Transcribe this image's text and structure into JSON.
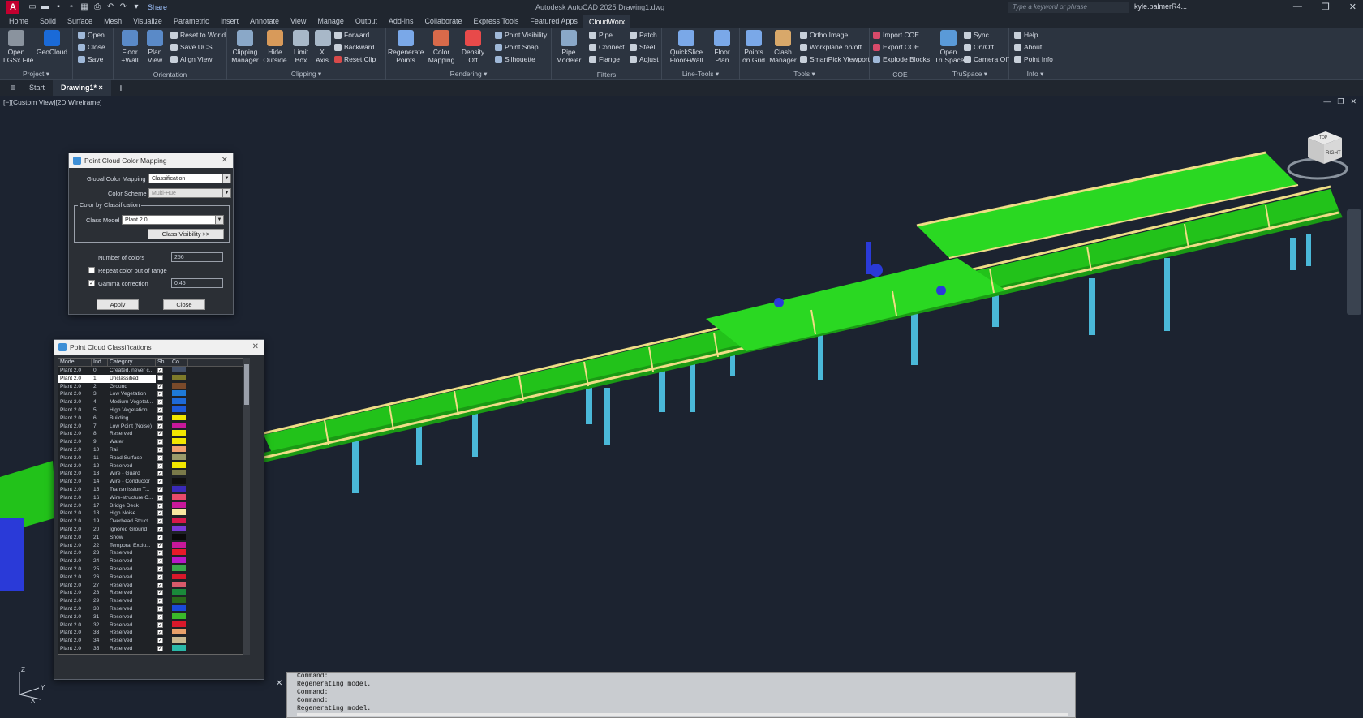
{
  "app": {
    "title": "Autodesk AutoCAD 2025 Drawing1.dwg",
    "share": "Share",
    "search_placeholder": "Type a keyword or phrase",
    "user": "kyle.palmerR4..."
  },
  "menu_tabs": [
    "Home",
    "Solid",
    "Surface",
    "Mesh",
    "Visualize",
    "Parametric",
    "Insert",
    "Annotate",
    "View",
    "Manage",
    "Output",
    "Add-ins",
    "Collaborate",
    "Express Tools",
    "Featured Apps",
    "CloudWorx"
  ],
  "active_menu_tab": "CloudWorx",
  "ribbon": {
    "project": {
      "title": "Project ▾",
      "open_lgsx": "Open\nLGSx File",
      "geocloud": "GeoCloud",
      "open": "Open",
      "close": "Close",
      "save": "Save"
    },
    "orientation": {
      "title": "Orientation",
      "floor_wall": "Floor\n+Wall",
      "plan_view": "Plan\nView",
      "reset_world": "Reset to World",
      "save_ucs": "Save UCS",
      "align_view": "Align View"
    },
    "clipping": {
      "title": "Clipping ▾",
      "clipping_manager": "Clipping\nManager",
      "hide_outside": "Hide\nOutside",
      "limit_box": "Limit\nBox",
      "x_axis": "X\nAxis",
      "forward": "Forward",
      "backward": "Backward",
      "reset_clip": "Reset Clip"
    },
    "rendering": {
      "title": "Rendering ▾",
      "regenerate": "Regenerate\nPoints",
      "color_mapping": "Color\nMapping",
      "density_off": "Density\nOff",
      "point_visibility": "Point Visibility",
      "point_snap": "Point Snap",
      "silhouette": "Silhouette"
    },
    "fitters": {
      "title": "Fitters",
      "pipe_modeler": "Pipe\nModeler",
      "pipe": "Pipe",
      "connect": "Connect",
      "flange": "Flange",
      "patch": "Patch",
      "steel": "Steel",
      "adjust": "Adjust"
    },
    "line_tools": {
      "title": "Line-Tools ▾",
      "quickslice": "QuickSlice\nFloor+Wall",
      "floor_plan": "Floor\nPlan"
    },
    "tools": {
      "title": "Tools ▾",
      "points_on_grid": "Points\non Grid",
      "clash_manager": "Clash\nManager",
      "ortho_image": "Ortho Image...",
      "workplane": "Workplane on/off",
      "smartpick": "SmartPick Viewport"
    },
    "coe": {
      "title": "COE",
      "import_coe": "Import COE",
      "export_coe": "Export COE",
      "explode_blocks": "Explode Blocks"
    },
    "truspace": {
      "title": "TruSpace ▾",
      "open_truspace": "Open\nTruSpace",
      "sync": "Sync...",
      "on_off": "On/Off",
      "camera_off": "Camera Off"
    },
    "info": {
      "title": "Info ▾",
      "help": "Help",
      "about": "About",
      "point_info": "Point Info"
    }
  },
  "doc_tabs": {
    "start": "Start",
    "drawing": "Drawing1*",
    "drawing_close": "×"
  },
  "viewport": {
    "label": "[−][Custom View][2D Wireframe]",
    "viewcube_face": "RIGHT",
    "viewcube_top": "TOP"
  },
  "color_mapping_dialog": {
    "title": "Point Cloud Color Mapping",
    "global_color_mapping_label": "Global Color Mapping",
    "global_color_mapping_value": "Classification",
    "color_scheme_label": "Color Scheme",
    "color_scheme_value": "Multi-Hue",
    "group_title": "Color by Classification",
    "class_model_label": "Class Model",
    "class_model_value": "Plant 2.0",
    "class_visibility": "Class Visibility >>",
    "number_of_colors_label": "Number of colors",
    "number_of_colors_value": "256",
    "repeat_label": "Repeat color out of range",
    "repeat_checked": false,
    "gamma_label": "Gamma correction",
    "gamma_checked": true,
    "gamma_value": "0.45",
    "apply": "Apply",
    "close": "Close"
  },
  "classification_dialog": {
    "title": "Point Cloud Classifications",
    "columns": [
      "Model",
      "Ind...",
      "Category",
      "Sh...",
      "Co..."
    ],
    "selected_index": 1,
    "rows": [
      {
        "model": "Plant 2.0",
        "idx": "0",
        "cat": "Created, never c...",
        "shown": true,
        "color": "#44526a"
      },
      {
        "model": "Plant 2.0",
        "idx": "1",
        "cat": "Unclassified",
        "shown": false,
        "color": "#7d7a2a"
      },
      {
        "model": "Plant 2.0",
        "idx": "2",
        "cat": "Ground",
        "shown": true,
        "color": "#7a4a2a"
      },
      {
        "model": "Plant 2.0",
        "idx": "3",
        "cat": "Low Vegetation",
        "shown": true,
        "color": "#1e7ad8"
      },
      {
        "model": "Plant 2.0",
        "idx": "4",
        "cat": "Medium Vegetat...",
        "shown": true,
        "color": "#1e6ad8"
      },
      {
        "model": "Plant 2.0",
        "idx": "5",
        "cat": "High Vegetation",
        "shown": true,
        "color": "#1e5ad8"
      },
      {
        "model": "Plant 2.0",
        "idx": "6",
        "cat": "Building",
        "shown": true,
        "color": "#f2e600"
      },
      {
        "model": "Plant 2.0",
        "idx": "7",
        "cat": "Low Point (Noise)",
        "shown": true,
        "color": "#c8189a"
      },
      {
        "model": "Plant 2.0",
        "idx": "8",
        "cat": "Reserved",
        "shown": true,
        "color": "#f2e600"
      },
      {
        "model": "Plant 2.0",
        "idx": "9",
        "cat": "Water",
        "shown": true,
        "color": "#f2e600"
      },
      {
        "model": "Plant 2.0",
        "idx": "10",
        "cat": "Rail",
        "shown": true,
        "color": "#f0a070"
      },
      {
        "model": "Plant 2.0",
        "idx": "11",
        "cat": "Road Surface",
        "shown": true,
        "color": "#9a9a6a"
      },
      {
        "model": "Plant 2.0",
        "idx": "12",
        "cat": "Reserved",
        "shown": true,
        "color": "#f2e600"
      },
      {
        "model": "Plant 2.0",
        "idx": "13",
        "cat": "Wire - Guard",
        "shown": true,
        "color": "#7a7a4a"
      },
      {
        "model": "Plant 2.0",
        "idx": "14",
        "cat": "Wire - Conductor",
        "shown": true,
        "color": "#111111"
      },
      {
        "model": "Plant 2.0",
        "idx": "15",
        "cat": "Transmission T...",
        "shown": true,
        "color": "#3a2ab8"
      },
      {
        "model": "Plant 2.0",
        "idx": "16",
        "cat": "Wire-structure C...",
        "shown": true,
        "color": "#e84a6a"
      },
      {
        "model": "Plant 2.0",
        "idx": "17",
        "cat": "Bridge Deck",
        "shown": true,
        "color": "#c8189a"
      },
      {
        "model": "Plant 2.0",
        "idx": "18",
        "cat": "High Noise",
        "shown": true,
        "color": "#f8e8a0"
      },
      {
        "model": "Plant 2.0",
        "idx": "19",
        "cat": "Overhead Struct...",
        "shown": true,
        "color": "#d8184a"
      },
      {
        "model": "Plant 2.0",
        "idx": "20",
        "cat": "Ignored Ground",
        "shown": true,
        "color": "#7a3ad8"
      },
      {
        "model": "Plant 2.0",
        "idx": "21",
        "cat": "Snow",
        "shown": true,
        "color": "#0a0a0a"
      },
      {
        "model": "Plant 2.0",
        "idx": "22",
        "cat": "Temporal Exclu...",
        "shown": true,
        "color": "#c8189a"
      },
      {
        "model": "Plant 2.0",
        "idx": "23",
        "cat": "Reserved",
        "shown": true,
        "color": "#e81a2a"
      },
      {
        "model": "Plant 2.0",
        "idx": "24",
        "cat": "Reserved",
        "shown": true,
        "color": "#b818c8"
      },
      {
        "model": "Plant 2.0",
        "idx": "25",
        "cat": "Reserved",
        "shown": true,
        "color": "#3aa84a"
      },
      {
        "model": "Plant 2.0",
        "idx": "26",
        "cat": "Reserved",
        "shown": true,
        "color": "#d8182a"
      },
      {
        "model": "Plant 2.0",
        "idx": "27",
        "cat": "Reserved",
        "shown": true,
        "color": "#d85a6a"
      },
      {
        "model": "Plant 2.0",
        "idx": "28",
        "cat": "Reserved",
        "shown": true,
        "color": "#1a8a3a"
      },
      {
        "model": "Plant 2.0",
        "idx": "29",
        "cat": "Reserved",
        "shown": true,
        "color": "#2a6a1a"
      },
      {
        "model": "Plant 2.0",
        "idx": "30",
        "cat": "Reserved",
        "shown": true,
        "color": "#1a4ad8"
      },
      {
        "model": "Plant 2.0",
        "idx": "31",
        "cat": "Reserved",
        "shown": true,
        "color": "#3ab82a"
      },
      {
        "model": "Plant 2.0",
        "idx": "32",
        "cat": "Reserved",
        "shown": true,
        "color": "#d8182a"
      },
      {
        "model": "Plant 2.0",
        "idx": "33",
        "cat": "Reserved",
        "shown": true,
        "color": "#e8a06a"
      },
      {
        "model": "Plant 2.0",
        "idx": "34",
        "cat": "Reserved",
        "shown": true,
        "color": "#c8b890"
      },
      {
        "model": "Plant 2.0",
        "idx": "35",
        "cat": "Reserved",
        "shown": true,
        "color": "#2ab8a8"
      }
    ]
  },
  "command_line": [
    "Command:",
    "Regenerating model.",
    "Command:",
    "Command:",
    "Regenerating model."
  ],
  "ucs": {
    "x": "X",
    "y": "Y",
    "z": "Z"
  },
  "colors": {
    "structure_green": "#22c21a",
    "pillar_cyan": "#4ab8d8",
    "beam_yellow": "#efdd86",
    "accent_blue": "#2a3ad8",
    "background": "#1c2330"
  }
}
